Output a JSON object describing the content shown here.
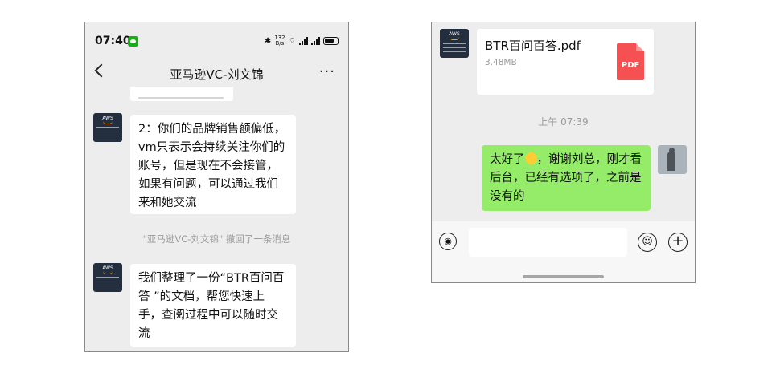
{
  "left_screen": {
    "status_bar": {
      "time": "07:40",
      "speed_top": "132",
      "speed_bottom": "B/s",
      "icons": [
        "wechat-icon",
        "bluetooth-icon",
        "wifi-icon",
        "signal-icon",
        "signal-icon",
        "battery-icon"
      ]
    },
    "header": {
      "title": "亚马逊VC-刘文锦",
      "back_icon": "chevron-left-icon",
      "more_label": "···"
    },
    "messages": [
      {
        "type": "text",
        "from": "contact",
        "text": "2：你们的品牌销售额偏低，vm只表示会持续关注你们的账号，但是现在不会接管，如果有问题，可以通过我们来和她交流"
      },
      {
        "type": "system",
        "text": "\"亚马逊VC-刘文锦\" 撤回了一条消息"
      },
      {
        "type": "text",
        "from": "contact",
        "text": "我们整理了一份“BTR百问百答 ”的文档，帮您快速上手，查阅过程中可以随时交流"
      }
    ]
  },
  "right_screen": {
    "file": {
      "name": "BTR百问百答.pdf",
      "size": "3.48MB",
      "icon_label": "PDF"
    },
    "timestamp": "上午 07:39",
    "reply": {
      "text_before": "太好了",
      "text_after": "，谢谢刘总，刚才看后台，已经有选项了，之前是没有的",
      "emoji": "grinning-face-emoji"
    },
    "input_bar": {
      "voice_icon": "voice-icon",
      "emoji_icon": "smiley-icon",
      "plus_icon": "plus-icon",
      "value": ""
    }
  },
  "avatar_text": "AWS"
}
